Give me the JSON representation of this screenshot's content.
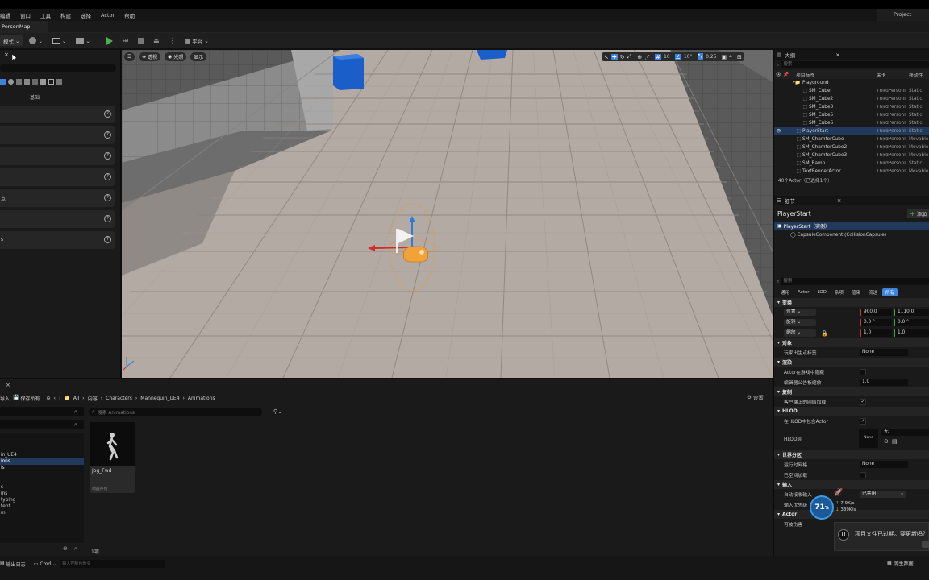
{
  "menu": [
    "编辑",
    "窗口",
    "工具",
    "构建",
    "选择",
    "Actor",
    "帮助"
  ],
  "project_label": "Project",
  "map_tab": "PersonMap",
  "toolbar": {
    "mode_label": "模式",
    "platform_label": "平台"
  },
  "left_panel": {
    "category_label": "基础",
    "items": [
      "",
      "",
      "",
      "",
      "点",
      "",
      "s"
    ]
  },
  "viewport": {
    "perspective_label": "透视",
    "lit_label": "光照",
    "show_label": "显示",
    "grid_snap": "10",
    "rot_snap": "10°",
    "scale_snap": "0.25",
    "camera_speed": "4"
  },
  "outliner": {
    "title": "大纲",
    "search_placeholder": "搜索",
    "col_label": "项目标签",
    "col_level": "关卡",
    "col_mobility": "移动性",
    "rows": [
      {
        "name": "Playground",
        "level": "",
        "mobility": "",
        "indent": 1,
        "folder": true
      },
      {
        "name": "SM_Cube",
        "level": "ThirdPersonl",
        "mobility": "Static",
        "indent": 2
      },
      {
        "name": "SM_Cube2",
        "level": "ThirdPersonl",
        "mobility": "Static",
        "indent": 2
      },
      {
        "name": "SM_Cube3",
        "level": "ThirdPersonl",
        "mobility": "Static",
        "indent": 2
      },
      {
        "name": "SM_Cube5",
        "level": "ThirdPersonl",
        "mobility": "Static",
        "indent": 2
      },
      {
        "name": "SM_Cube6",
        "level": "ThirdPersonl",
        "mobility": "Static",
        "indent": 2
      },
      {
        "name": "PlayerStart",
        "level": "ThirdPersonl",
        "mobility": "Static",
        "indent": 1,
        "selected": true
      },
      {
        "name": "SM_ChamferCube",
        "level": "ThirdPersonl",
        "mobility": "Movable",
        "indent": 1
      },
      {
        "name": "SM_ChamferCube2",
        "level": "ThirdPersonl",
        "mobility": "Movable",
        "indent": 1
      },
      {
        "name": "SM_ChamferCube3",
        "level": "ThirdPersonl",
        "mobility": "Movable",
        "indent": 1
      },
      {
        "name": "SM_Ramp",
        "level": "ThirdPersonl",
        "mobility": "Static",
        "indent": 1
      },
      {
        "name": "TextRenderActor",
        "level": "ThirdPersonl",
        "mobility": "Movable",
        "indent": 1
      }
    ],
    "count_text": "40个Actor（已选择1个）"
  },
  "details": {
    "title": "细节",
    "actor_name": "PlayerStart",
    "add_button": "添加",
    "instance_label": "PlayerStart（实例）",
    "component_label": "CapsuleComponent (CollisionCapsule)",
    "search_placeholder": "搜索",
    "filter_tabs": [
      "通用",
      "Actor",
      "LOD",
      "杂项",
      "渲染",
      "流送",
      "所有"
    ],
    "transform_header": "变换",
    "location_label": "位置",
    "location_x": "900.0",
    "location_y": "1110.0",
    "rotation_label": "旋转",
    "rotation_x": "0.0 °",
    "rotation_y": "0.0 °",
    "scale_label": "缩放",
    "scale_x": "1.0",
    "scale_y": "1.0",
    "object_header": "对象",
    "player_start_tag_label": "玩家出生点标签",
    "player_start_tag_value": "None",
    "rendering_header": "渲染",
    "hidden_in_game_label": "Actor在游戏中隐藏",
    "editor_billboard_label": "编辑器公告板缩放",
    "editor_billboard_value": "1.0",
    "replication_header": "复制",
    "net_load_label": "客户端上的网络加载",
    "hlod_header": "HLOD",
    "include_hlod_label": "在HLOD中包含Actor",
    "hlod_layer_label": "HLOD层",
    "hlod_thumb_text": "None",
    "hlod_layer_value": "无",
    "world_partition_header": "世界分区",
    "runtime_grid_label": "运行时网格",
    "runtime_grid_value": "None",
    "spatially_loaded_label": "已空间加载",
    "input_header": "输入",
    "auto_receive_label": "自动接收输入",
    "auto_receive_value": "已禁用",
    "input_priority_label": "输入优先级",
    "actor_header": "Actor",
    "can_be_damaged_label": "可被伤害"
  },
  "content_browser": {
    "import_label": "导入",
    "save_all_label": "保存所有",
    "breadcrumbs": [
      "All",
      "内容",
      "Characters",
      "Mannequin_UE4",
      "Animations"
    ],
    "settings_label": "设置",
    "search_placeholder": "搜索 Animations",
    "folders": [
      "in_UE4",
      "ions",
      "ls",
      "s",
      "ins",
      "typing",
      "tent",
      "m"
    ],
    "asset_name": "Jog_Fwd",
    "asset_type": "动画序列",
    "item_count": "1项"
  },
  "status_bar": {
    "output_log": "输出日志",
    "cmd_label": "Cmd",
    "cmd_placeholder": "输入控制台命令",
    "source_control": "源生数据"
  },
  "perf_widget": {
    "percent": "71",
    "upload": "7.9",
    "download": "339",
    "unit": "K/s"
  },
  "notification": {
    "text": "项目文件已过期。要更新吗？"
  },
  "colors": {
    "accent": "#3d82dc",
    "selected_row": "#213a5c",
    "play_green": "#4bb04b"
  }
}
